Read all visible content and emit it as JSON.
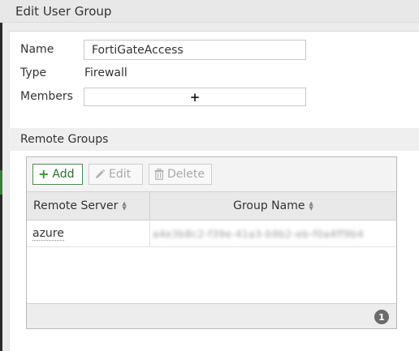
{
  "dialog": {
    "title": "Edit User Group"
  },
  "form": {
    "name_label": "Name",
    "name_value": "FortiGateAccess",
    "type_label": "Type",
    "type_value": "Firewall",
    "members_label": "Members",
    "members_add_glyph": "+"
  },
  "remote_groups": {
    "section_title": "Remote Groups",
    "toolbar": {
      "add_label": "Add",
      "edit_label": "Edit",
      "delete_label": "Delete"
    },
    "columns": [
      "Remote Server",
      "Group Name"
    ],
    "rows": [
      {
        "remote_server": "azure",
        "group_name": "a4e3b8c2-f39e-41a3-b9b2-eb-f0a4ff9b4"
      }
    ],
    "count": "1"
  },
  "colors": {
    "add_accent": "#3e8e3e",
    "badge": "#6b6b6b"
  }
}
